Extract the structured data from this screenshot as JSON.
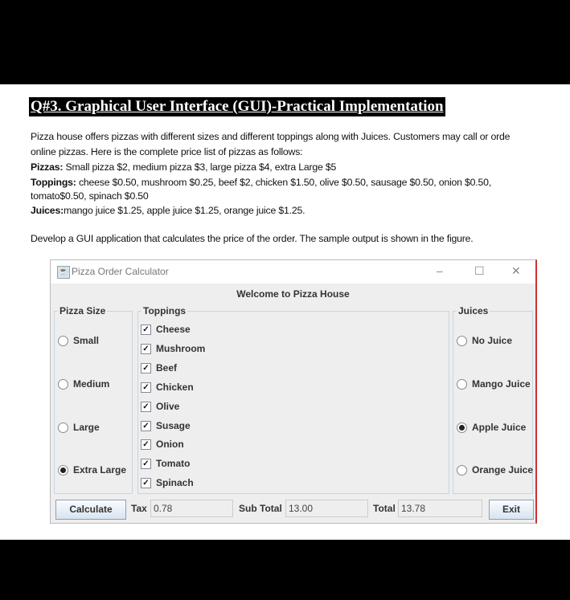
{
  "question": {
    "title": "Q#3. Graphical User Interface (GUI)-Practical Implementation",
    "intro1": "Pizza house offers pizzas with different sizes and different toppings along with Juices. Customers may call or orde",
    "intro2": "online pizzas. Here is the complete price list of pizzas as follows:",
    "pizzas_label": "Pizzas:",
    "pizzas_text": "Small pizza $2, medium pizza $3, large pizza $4, extra Large $5",
    "toppings_label": "Toppings:",
    "toppings_text": "cheese $0.50, mushroom $0.25, beef $2, chicken $1.50, olive $0.50, sausage $0.50, onion $0.50,",
    "toppings_text2": "tomato$0.50, spinach $0.50",
    "juices_label": "Juices:",
    "juices_text": "mango juice $1.25, apple juice $1.25, orange juice $1.25.",
    "task": "Develop a GUI application that calculates the price of the order. The sample output is shown in the figure."
  },
  "window": {
    "title": "Pizza Order Calculator",
    "minimize": "–",
    "maximize": "☐",
    "close": "✕",
    "welcome": "Welcome to Pizza House",
    "size_group": {
      "label": "Pizza Size",
      "options": [
        {
          "label": "Small",
          "selected": false
        },
        {
          "label": "Medium",
          "selected": false
        },
        {
          "label": "Large",
          "selected": false
        },
        {
          "label": "Extra Large",
          "selected": true
        }
      ]
    },
    "toppings_group": {
      "label": "Toppings",
      "items": [
        {
          "label": "Cheese",
          "checked": true
        },
        {
          "label": "Mushroom",
          "checked": true
        },
        {
          "label": "Beef",
          "checked": true
        },
        {
          "label": "Chicken",
          "checked": true
        },
        {
          "label": "Olive",
          "checked": true
        },
        {
          "label": "Susage",
          "checked": true
        },
        {
          "label": "Onion",
          "checked": true
        },
        {
          "label": "Tomato",
          "checked": true
        },
        {
          "label": "Spinach",
          "checked": true
        }
      ]
    },
    "juices_group": {
      "label": "Juices",
      "options": [
        {
          "label": "No Juice",
          "selected": false
        },
        {
          "label": "Mango Juice",
          "selected": false
        },
        {
          "label": "Apple Juice",
          "selected": true
        },
        {
          "label": "Orange Juice",
          "selected": false
        }
      ]
    },
    "calculate": "Calculate",
    "tax_label": "Tax",
    "tax": "0.78",
    "subtotal_label": "Sub Total",
    "subtotal": "13.00",
    "total_label": "Total",
    "total": "13.78",
    "exit": "Exit"
  }
}
